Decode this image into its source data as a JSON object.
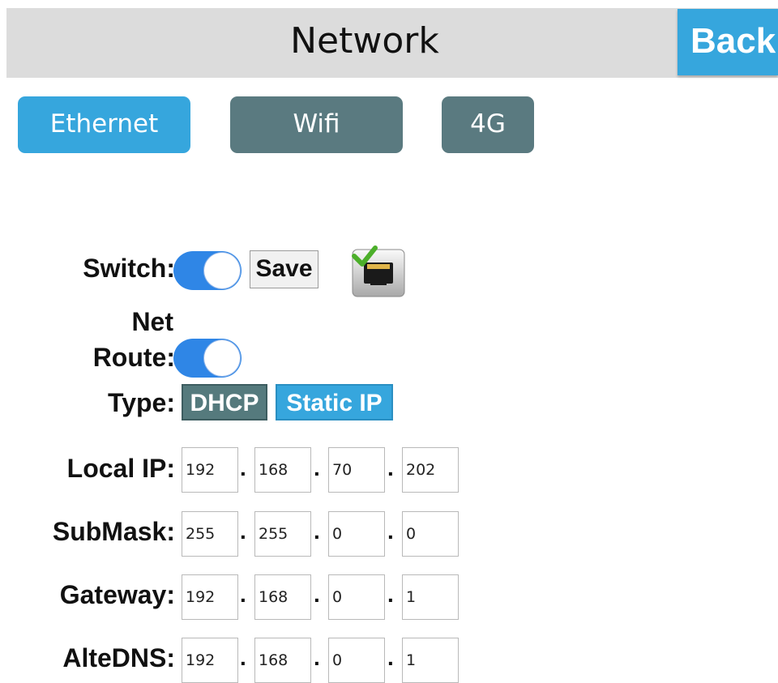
{
  "header": {
    "title": "Network",
    "back_label": "Back"
  },
  "tabs": [
    {
      "label": "Ethernet",
      "active": true
    },
    {
      "label": "Wifi",
      "active": false
    },
    {
      "label": "4G",
      "active": false
    }
  ],
  "form": {
    "switch_label": "Switch:",
    "switch_on": true,
    "save_label": "Save",
    "status_icon": "ethernet-connected-icon",
    "net_route_label_line1": "Net",
    "net_route_label_line2": "Route:",
    "net_route_on": true,
    "type_label": "Type:",
    "type_options": [
      "DHCP",
      "Static IP"
    ],
    "type_selected": "Static IP",
    "local_ip": {
      "label": "Local IP:",
      "octets": [
        "192",
        "168",
        "70",
        "202"
      ]
    },
    "submask": {
      "label": "SubMask:",
      "octets": [
        "255",
        "255",
        "0",
        "0"
      ]
    },
    "gateway": {
      "label": "Gateway:",
      "octets": [
        "192",
        "168",
        "0",
        "1"
      ]
    },
    "altdns": {
      "label": "AlteDNS:",
      "octets": [
        "192",
        "168",
        "0",
        "1"
      ]
    }
  },
  "colors": {
    "accent": "#36a6dd",
    "inactive_tab": "#5a7a80",
    "toggle_on": "#2f86e6",
    "header_bg": "#dcdcdc"
  }
}
